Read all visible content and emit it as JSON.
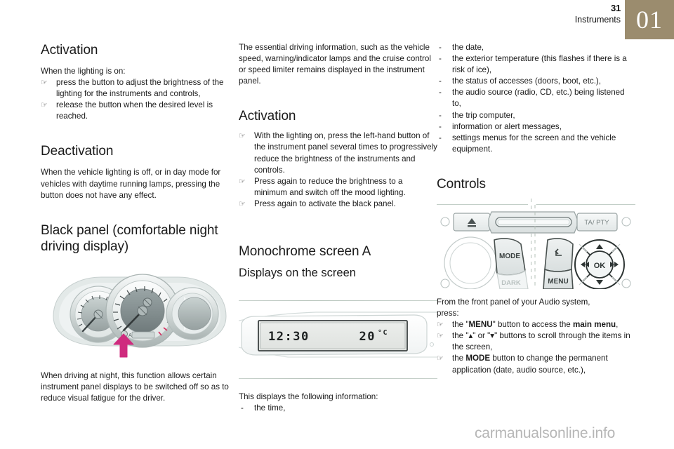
{
  "header": {
    "page_number": "31",
    "chapter_name": "Instruments",
    "chapter_badge": "01",
    "badge_color": "#9b8c6e"
  },
  "column1": {
    "heading_activation": "Activation",
    "intro": "When the lighting is on:",
    "activation_items": [
      "press the button to adjust the brightness of the lighting for the instruments and controls,",
      "release the button when the desired level is reached."
    ],
    "heading_deactivation": "Deactivation",
    "deactivation_text": "When the vehicle lighting is off, or in day mode for vehicles with daytime running lamps, pressing the button does not have any effect.",
    "heading_black_panel": "Black panel (comfortable night driving display)",
    "caption": "When driving at night, this function allows certain instrument panel displays to be switched off so as to reduce visual fatigue for the driver."
  },
  "column2": {
    "intro": "The essential driving information, such as the vehicle speed, warning/indicator lamps and the cruise control or speed limiter remains displayed in the instrument panel.",
    "heading_activation": "Activation",
    "activation_items": [
      "With the lighting on, press the left-hand button of the instrument panel several times to progressively reduce the brightness of the instruments and controls.",
      "Press again to reduce the brightness to a minimum and switch off the mood lighting.",
      "Press again to activate the black panel."
    ],
    "heading_mono": "Monochrome screen A",
    "subheading_displays": "Displays on the screen",
    "screen": {
      "time": "12:30",
      "temperature": "20",
      "temperature_unit": "°C"
    },
    "info_intro": "This displays the following information:",
    "info_first_item": "the time,"
  },
  "column3": {
    "info_items": [
      "the date,",
      "the exterior temperature (this flashes if there is a risk of ice),",
      "the status of accesses (doors, boot, etc.),",
      "the audio source (radio, CD, etc.) being listened to,",
      "the trip computer,",
      "information or alert messages,",
      "settings menus for the screen and the vehicle equipment."
    ],
    "heading_controls": "Controls",
    "panel_labels": {
      "eject": "▲",
      "ta_pty": "TA/ PTY",
      "mode": "MODE",
      "dark": "DARK",
      "menu": "MENU",
      "back": "↰",
      "ok": "OK",
      "up": "▲",
      "down": "▼",
      "prev": "◄◄",
      "next": "►►"
    },
    "controls_intro_line1": "From the front panel of your Audio system,",
    "controls_intro_line2": "press:",
    "controls_items": [
      {
        "parts": [
          {
            "t": "the \"",
            "b": false
          },
          {
            "t": "MENU",
            "b": true
          },
          {
            "t": "\" button to access the ",
            "b": false
          },
          {
            "t": "main menu",
            "b": true
          },
          {
            "t": ",",
            "b": false
          }
        ]
      },
      {
        "parts": [
          {
            "t": "the \"▴\" or \"▾\" buttons to scroll through the items in the screen,",
            "b": false
          }
        ]
      },
      {
        "parts": [
          {
            "t": "the ",
            "b": false
          },
          {
            "t": "MODE",
            "b": true
          },
          {
            "t": " button to change the permanent application (date, audio source, etc.),",
            "b": false
          }
        ]
      }
    ]
  },
  "watermark": "carmanualsonline.info",
  "icons": {
    "hand_bullet": "☞",
    "dash_bullet": "-"
  }
}
